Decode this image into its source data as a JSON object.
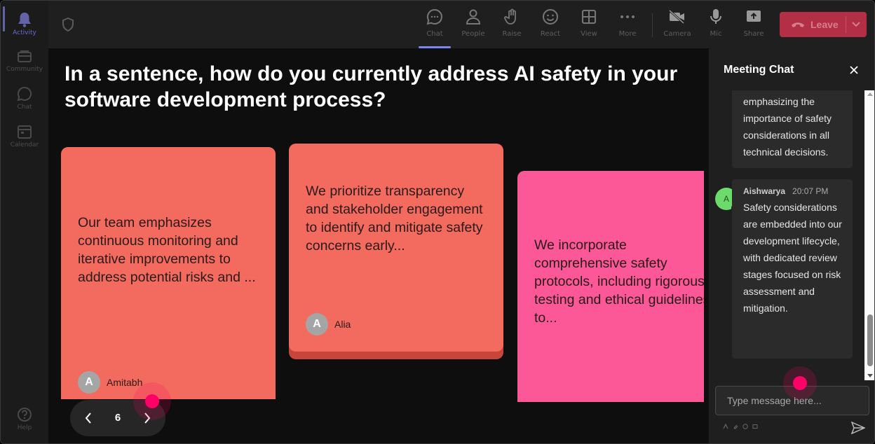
{
  "rail": {
    "items": [
      {
        "label": "Activity",
        "icon": "bell-icon"
      },
      {
        "label": "Community",
        "icon": "community-icon"
      },
      {
        "label": "Chat",
        "icon": "chat-icon"
      },
      {
        "label": "Calendar",
        "icon": "calendar-icon"
      }
    ],
    "help_label": "Help"
  },
  "toolbar": {
    "items": [
      {
        "label": "Chat",
        "icon": "chat-icon"
      },
      {
        "label": "People",
        "icon": "people-icon"
      },
      {
        "label": "Raise",
        "icon": "raise-hand-icon"
      },
      {
        "label": "React",
        "icon": "smiley-icon"
      },
      {
        "label": "View",
        "icon": "grid-icon"
      },
      {
        "label": "More",
        "icon": "more-icon"
      },
      {
        "label": "Camera",
        "icon": "camera-off-icon"
      },
      {
        "label": "Mic",
        "icon": "mic-icon"
      },
      {
        "label": "Share",
        "icon": "share-icon"
      }
    ],
    "leave_label": "Leave",
    "leave_color": "#c4314b"
  },
  "stage": {
    "question": "In a sentence, how do you currently address AI safety in your software development process?",
    "cards": [
      {
        "text": "Our team emphasizes continuous monitoring and iterative improvements to address potential risks and ...",
        "author_initial": "A",
        "author": "Amitabh",
        "color": "#f26b5e"
      },
      {
        "text": "We prioritize transparency and stakeholder engagement to identify and mitigate safety concerns early...",
        "author_initial": "A",
        "author": "Alia",
        "color": "#f26b5e"
      },
      {
        "text": "We incorporate comprehensive safety protocols, including rigorous testing and ethical guidelines, to...",
        "color": "#fc5796"
      }
    ],
    "pager": {
      "page": "6"
    }
  },
  "chat": {
    "title": "Meeting Chat",
    "messages": [
      {
        "text": "emphasizing the importance of safety considerations in all technical decisions."
      },
      {
        "avatar_initial": "A",
        "sender": "Aishwarya",
        "time": "20:07 PM",
        "text": "Safety considerations are embedded into our development lifecycle, with dedicated review stages focused on risk assessment and mitigation."
      }
    ],
    "placeholder": "Type message here..."
  }
}
